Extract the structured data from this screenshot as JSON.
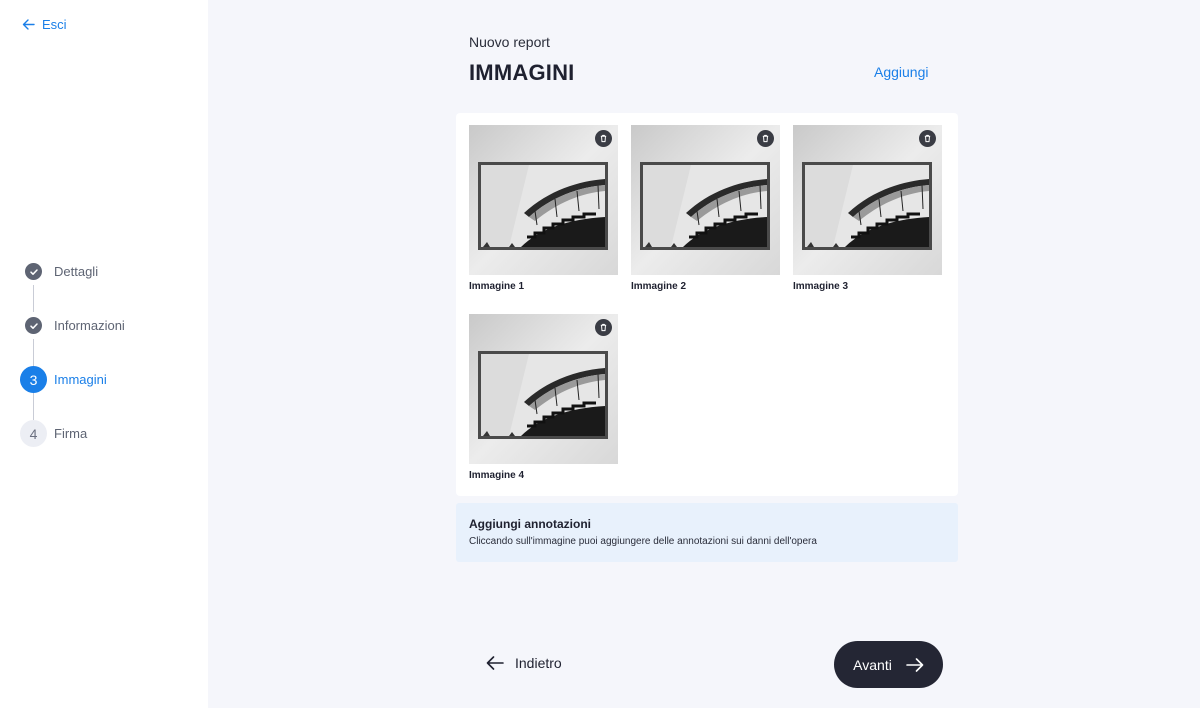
{
  "sidebar": {
    "exit_label": "Esci",
    "steps": [
      {
        "number": "1",
        "label": "Dettagli",
        "state": "done"
      },
      {
        "number": "2",
        "label": "Informazioni",
        "state": "done"
      },
      {
        "number": "3",
        "label": "Immagini",
        "state": "active"
      },
      {
        "number": "4",
        "label": "Firma",
        "state": "todo"
      }
    ]
  },
  "header": {
    "subtitle": "Nuovo report",
    "title": "IMMAGINI",
    "add_label": "Aggiungi"
  },
  "images": [
    {
      "label": "Immagine 1"
    },
    {
      "label": "Immagine 2"
    },
    {
      "label": "Immagine 3"
    },
    {
      "label": "Immagine 4"
    }
  ],
  "info": {
    "title": "Aggiungi annotazioni",
    "text": "Cliccando sull'immagine puoi aggiungere delle annotazioni sui danni dell'opera"
  },
  "footer": {
    "back_label": "Indietro",
    "next_label": "Avanti"
  },
  "colors": {
    "accent": "#1a7fe8",
    "dark_button": "#242634",
    "info_background": "#e8f1fc"
  }
}
